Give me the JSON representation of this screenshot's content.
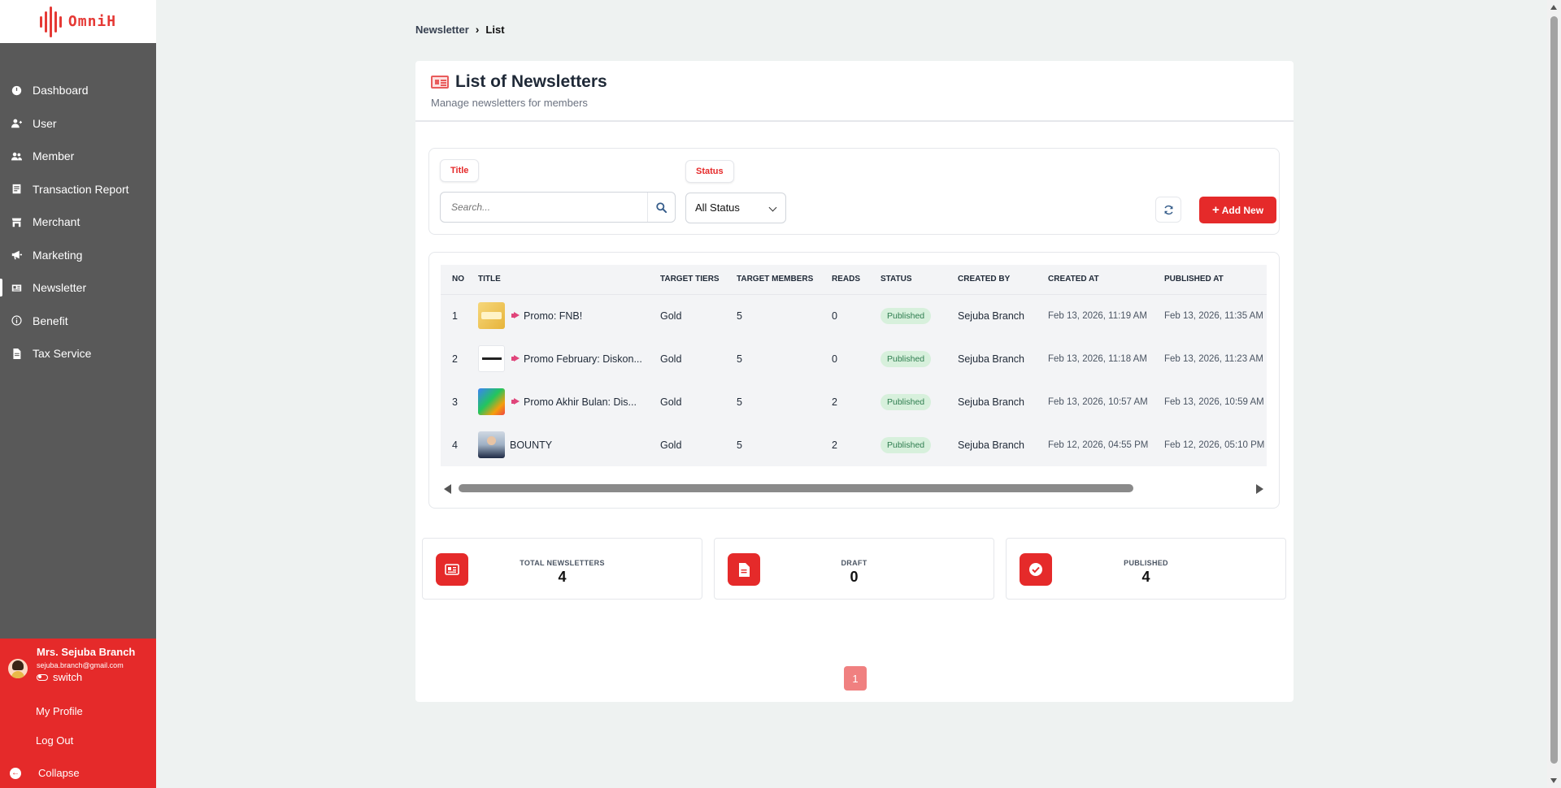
{
  "app": {
    "logo_text": "OmniH",
    "brand_color": "#e52a2a"
  },
  "sidebar": {
    "items": [
      {
        "label": "Dashboard",
        "icon": "dashboard-icon"
      },
      {
        "label": "User",
        "icon": "user-icon"
      },
      {
        "label": "Member",
        "icon": "members-icon"
      },
      {
        "label": "Transaction Report",
        "icon": "report-icon"
      },
      {
        "label": "Merchant",
        "icon": "store-icon"
      },
      {
        "label": "Marketing",
        "icon": "megaphone-icon"
      },
      {
        "label": "Newsletter",
        "icon": "newspaper-icon",
        "active": true
      },
      {
        "label": "Benefit",
        "icon": "info-icon"
      },
      {
        "label": "Tax Service",
        "icon": "document-icon"
      }
    ],
    "user": {
      "name": "Mrs. Sejuba Branch",
      "email": "sejuba.branch@gmail.com",
      "switch_label": "switch",
      "profile_label": "My Profile",
      "logout_label": "Log Out",
      "collapse_label": "Collapse"
    }
  },
  "breadcrumb": {
    "parent": "Newsletter",
    "current": "List"
  },
  "page": {
    "title": "List of Newsletters",
    "subtitle": "Manage newsletters for members"
  },
  "filters": {
    "title_chip": "Title",
    "status_chip": "Status",
    "search_placeholder": "Search...",
    "status_value": "All Status",
    "add_label": "Add New"
  },
  "table": {
    "columns": [
      "NO",
      "TITLE",
      "TARGET TIERS",
      "TARGET MEMBERS",
      "READS",
      "STATUS",
      "CREATED BY",
      "CREATED AT",
      "PUBLISHED AT"
    ],
    "rows": [
      {
        "no": "1",
        "title": "Promo: FNB!",
        "promo": true,
        "thumb": "yellow",
        "tiers": "Gold",
        "members": "5",
        "reads": "0",
        "status": "Published",
        "created_by": "Sejuba Branch",
        "created_at": "Feb 13, 2026, 11:19 AM",
        "published_at": "Feb 13, 2026, 11:35 AM"
      },
      {
        "no": "2",
        "title": "Promo February: Diskon...",
        "promo": true,
        "thumb": "hotel",
        "tiers": "Gold",
        "members": "5",
        "reads": "0",
        "status": "Published",
        "created_by": "Sejuba Branch",
        "created_at": "Feb 13, 2026, 11:18 AM",
        "published_at": "Feb 13, 2026, 11:23 AM"
      },
      {
        "no": "3",
        "title": "Promo Akhir Bulan: Dis...",
        "promo": true,
        "thumb": "colorful",
        "tiers": "Gold",
        "members": "5",
        "reads": "2",
        "status": "Published",
        "created_by": "Sejuba Branch",
        "created_at": "Feb 13, 2026, 10:57 AM",
        "published_at": "Feb 13, 2026, 10:59 AM"
      },
      {
        "no": "4",
        "title": "BOUNTY",
        "promo": false,
        "thumb": "person",
        "tiers": "Gold",
        "members": "5",
        "reads": "2",
        "status": "Published",
        "created_by": "Sejuba Branch",
        "created_at": "Feb 12, 2026, 04:55 PM",
        "published_at": "Feb 12, 2026, 05:10 PM"
      }
    ]
  },
  "stats": [
    {
      "label": "TOTAL NEWSLETTERS",
      "value": "4",
      "icon": "newspaper-icon"
    },
    {
      "label": "DRAFT",
      "value": "0",
      "icon": "document-icon"
    },
    {
      "label": "PUBLISHED",
      "value": "4",
      "icon": "check-circle-icon"
    }
  ],
  "pagination": {
    "current": "1"
  }
}
